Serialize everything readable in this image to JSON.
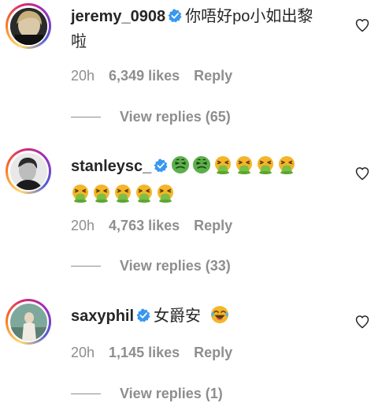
{
  "comments": [
    {
      "username": "jeremy_0908",
      "verified": true,
      "text_line1": "你唔好po小如出黎",
      "text_line2": "啦",
      "time": "20h",
      "likes": "6,349 likes",
      "reply": "Reply",
      "view_replies": "View replies (65)"
    },
    {
      "username": "stanleysc_",
      "verified": true,
      "emojis_line1": [
        "nauseated-face",
        "nauseated-face",
        "face-vomiting",
        "face-vomiting",
        "face-vomiting",
        "face-vomiting"
      ],
      "emojis_line2": [
        "face-vomiting",
        "face-vomiting",
        "face-vomiting",
        "face-vomiting",
        "face-vomiting"
      ],
      "time": "20h",
      "likes": "4,763 likes",
      "reply": "Reply",
      "view_replies": "View replies (33)"
    },
    {
      "username": "saxyphil",
      "verified": true,
      "text": "女爵安",
      "emoji": "face-with-tears-of-joy",
      "time": "20h",
      "likes": "1,145 likes",
      "reply": "Reply",
      "view_replies": "View replies (1)"
    }
  ],
  "colors": {
    "text": "#262626",
    "muted": "#8e8e8e",
    "verified": "#3897f0",
    "nauseated_face": "#5bb04a",
    "vomit_face": "#f5b52a"
  }
}
